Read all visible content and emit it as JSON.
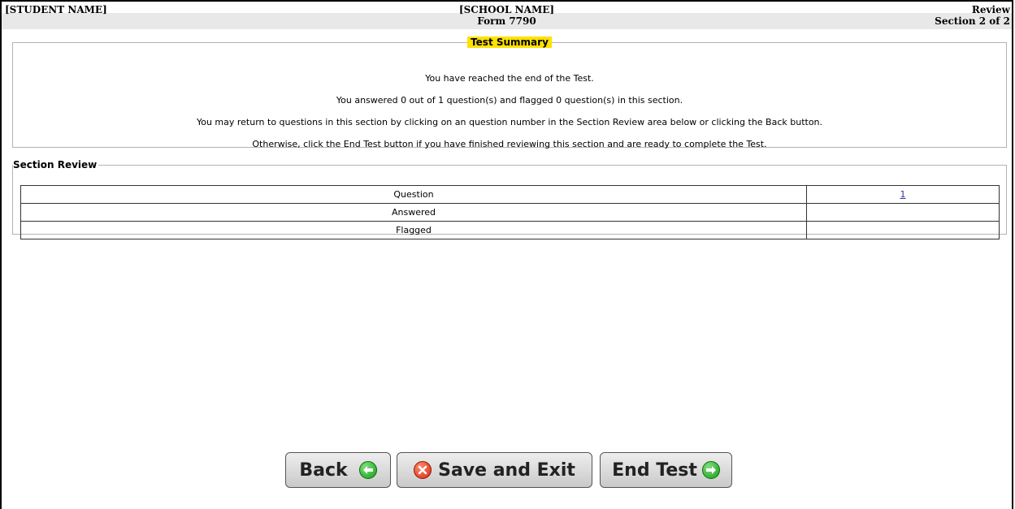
{
  "header": {
    "student_name": "[STUDENT NAME]",
    "school_name": "[SCHOOL NAME]",
    "form": "Form 7790",
    "mode": "Review",
    "section": "Section 2 of 2"
  },
  "summary": {
    "legend": "Test Summary",
    "lines": [
      "You have reached the end of the Test.",
      "You answered 0 out of 1 question(s) and flagged 0 question(s) in this section.",
      "You may return to questions in this section by clicking on an question number in the Section Review area below or clicking the Back button.",
      "Otherwise, click the End Test button if you have finished reviewing this section and are ready to complete the Test."
    ]
  },
  "review": {
    "legend": "Section Review",
    "rows": [
      {
        "label": "Question",
        "value": "1"
      },
      {
        "label": "Answered",
        "value": ""
      },
      {
        "label": "Flagged",
        "value": ""
      }
    ]
  },
  "buttons": {
    "back": "Back",
    "save_exit": "Save and Exit",
    "end_test": "End Test"
  },
  "icons": {
    "back": "arrow-left-circle-icon",
    "save_exit": "close-circle-icon",
    "end_test": "arrow-right-circle-icon"
  },
  "colors": {
    "legend_highlight": "#ffe100",
    "header_band": "#e8e8e8",
    "icon_green": "#169c16",
    "icon_red": "#d92a10"
  }
}
